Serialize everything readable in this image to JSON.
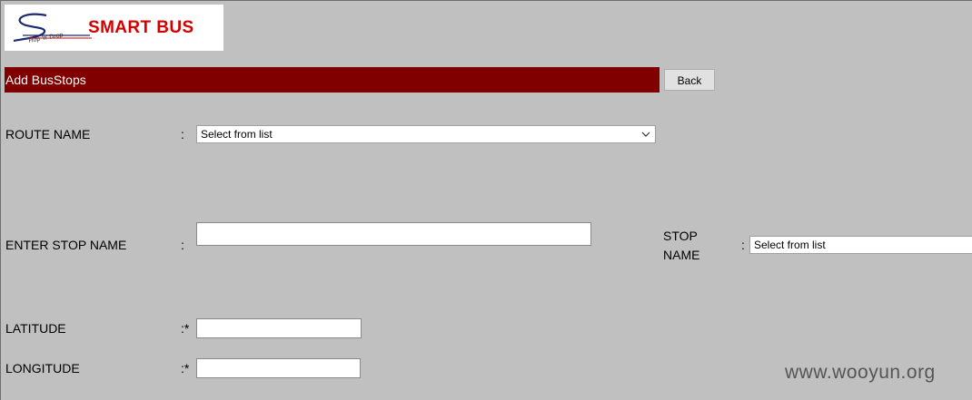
{
  "logo": {
    "brand": "SMART BUS",
    "tagline": "Hop 'n' Drop"
  },
  "page": {
    "title": "Add BusStops",
    "back_label": "Back"
  },
  "form": {
    "route_name": {
      "label": "ROUTE NAME",
      "colon": ":",
      "selected": "Select from list"
    },
    "stop_name_entry": {
      "label": "ENTER STOP NAME",
      "colon": ":",
      "value": ""
    },
    "stop_name_select": {
      "label_line1": "STOP",
      "label_line2": "NAME",
      "colon": ":",
      "selected": "Select from list"
    },
    "latitude": {
      "label": "LATITUDE",
      "colon": ":*",
      "value": ""
    },
    "longitude": {
      "label": "LONGITUDE",
      "colon": ":*",
      "value": ""
    }
  },
  "watermark": "www.wooyun.org"
}
